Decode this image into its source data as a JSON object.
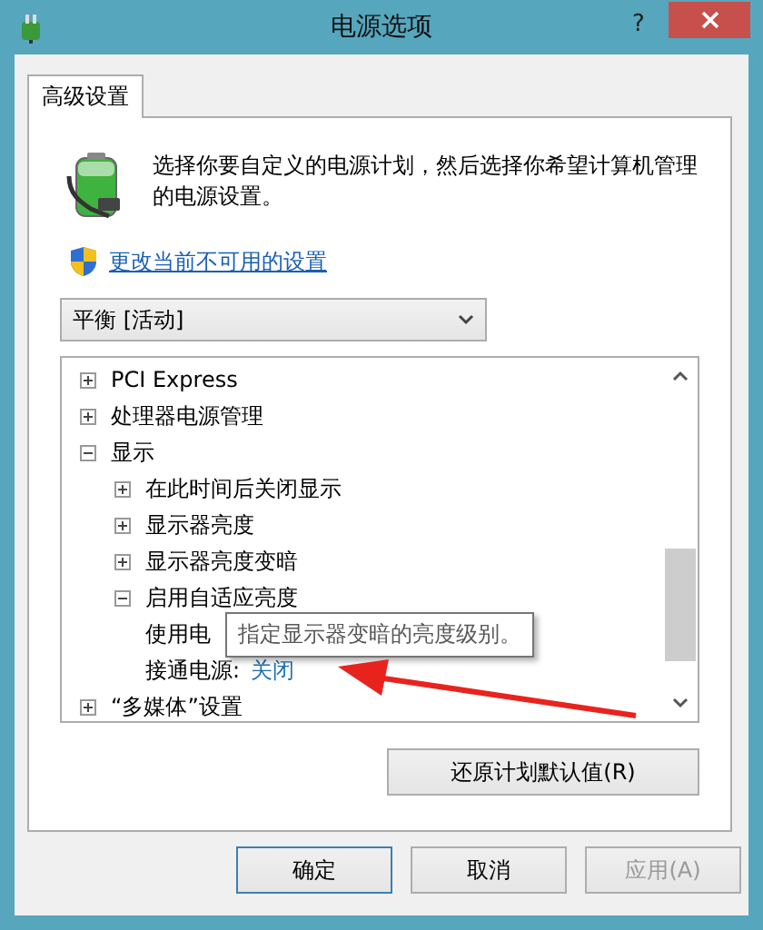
{
  "window": {
    "title": "电源选项",
    "help": "?"
  },
  "tabs": [
    {
      "label": "高级设置",
      "selected": true
    }
  ],
  "description": "选择你要自定义的电源计划，然后选择你希望计算机管理的电源设置。",
  "link": "更改当前不可用的设置",
  "plan_select": {
    "value": "平衡 [活动]"
  },
  "tree": {
    "items": [
      {
        "kind": "group",
        "label": "PCI Express",
        "expanded": false
      },
      {
        "kind": "group",
        "label": "处理器电源管理",
        "expanded": false
      },
      {
        "kind": "group",
        "label": "显示",
        "expanded": true,
        "children": [
          {
            "kind": "group",
            "label": "在此时间后关闭显示",
            "expanded": false
          },
          {
            "kind": "group",
            "label": "显示器亮度",
            "expanded": false
          },
          {
            "kind": "group",
            "label": "显示器亮度变暗",
            "expanded": false
          },
          {
            "kind": "group",
            "label": "启用自适应亮度",
            "expanded": true,
            "children": [
              {
                "kind": "setting",
                "label": "使用电"
              },
              {
                "kind": "setting",
                "label": "接通电源:",
                "value": "关闭"
              }
            ]
          }
        ]
      },
      {
        "kind": "group",
        "label": "“多媒体”设置",
        "expanded": false
      }
    ]
  },
  "tooltip": "指定显示器变暗的亮度级别。",
  "restore_button": "还原计划默认值(R)",
  "buttons": [
    {
      "label": "确定",
      "default": true,
      "disabled": false
    },
    {
      "label": "取消",
      "default": false,
      "disabled": false
    },
    {
      "label": "应用(A)",
      "default": false,
      "disabled": true
    }
  ]
}
